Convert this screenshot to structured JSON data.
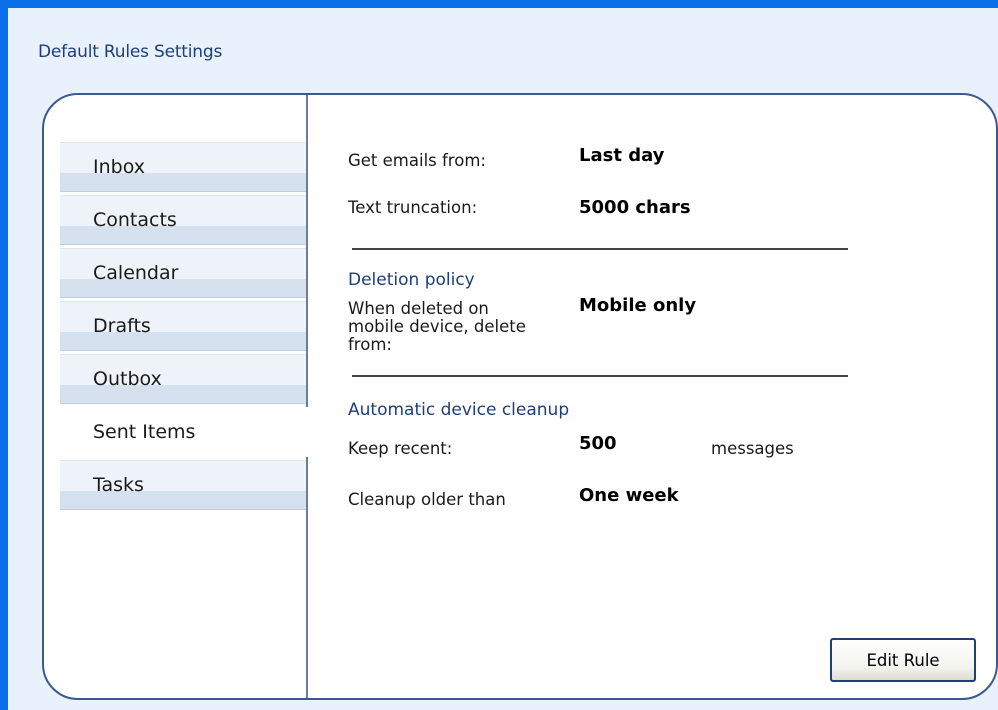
{
  "window": {
    "title": "Default Rules Settings"
  },
  "tabs": [
    {
      "label": "Inbox",
      "active": false
    },
    {
      "label": "Contacts",
      "active": false
    },
    {
      "label": "Calendar",
      "active": false
    },
    {
      "label": "Drafts",
      "active": false
    },
    {
      "label": "Outbox",
      "active": false
    },
    {
      "label": "Sent Items",
      "active": true
    },
    {
      "label": "Tasks",
      "active": false
    }
  ],
  "settings": {
    "get_emails_label": "Get emails from:",
    "get_emails_value": "Last day",
    "truncation_label": "Text truncation:",
    "truncation_value": "5000 chars",
    "deletion_section": "Deletion policy",
    "deletion_label_line1": "When deleted on",
    "deletion_label_line2": "mobile device, delete",
    "deletion_label_line3": "from:",
    "deletion_value": "Mobile only",
    "cleanup_section": "Automatic device cleanup",
    "keep_recent_label": "Keep recent:",
    "keep_recent_value": "500",
    "keep_recent_unit": "messages",
    "cleanup_older_label": "Cleanup older than",
    "cleanup_older_value": "One week"
  },
  "actions": {
    "edit_rule_label": "Edit Rule"
  },
  "colors": {
    "window_border": "#0a6fe8",
    "window_bg": "#e8f1fc",
    "panel_border": "#3a5a8e",
    "section_text": "#1c3f78"
  }
}
